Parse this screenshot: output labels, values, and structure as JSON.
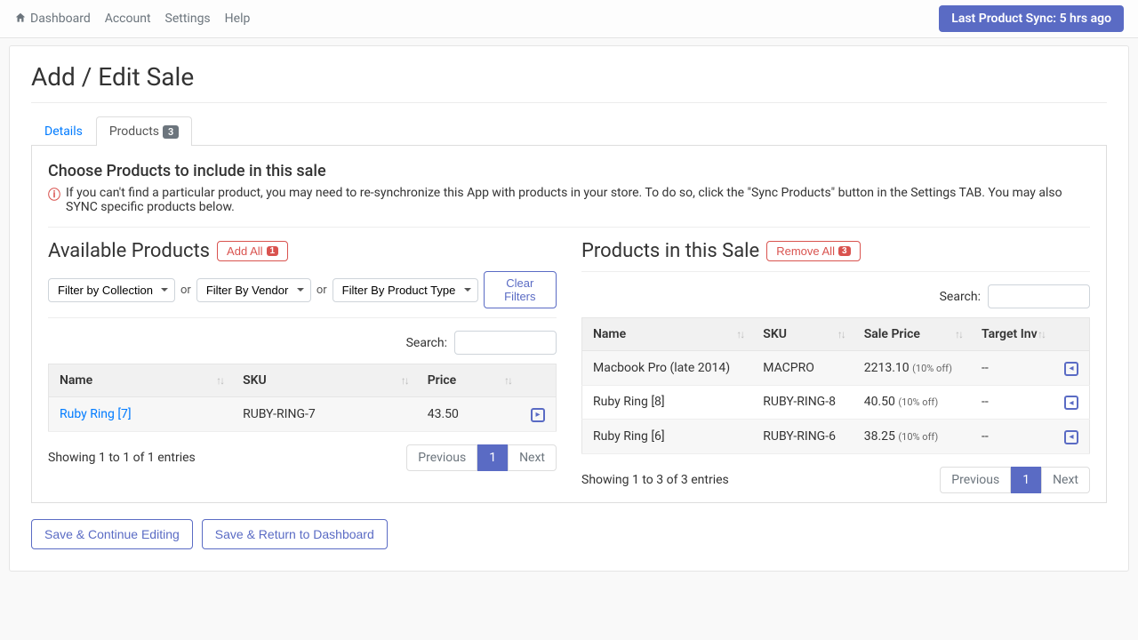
{
  "topbar": {
    "nav": {
      "dashboard": "Dashboard",
      "account": "Account",
      "settings": "Settings",
      "help": "Help"
    },
    "sync_label": "Last Product Sync: 5 hrs ago"
  },
  "page": {
    "title": "Add / Edit Sale"
  },
  "tabs": {
    "details": "Details",
    "products": "Products",
    "products_count": "3"
  },
  "choose": {
    "heading": "Choose Products to include in this sale",
    "help": "If you can't find a particular product, you may need to re-synchronize this App with products in your store. To do so, click the \"Sync Products\" button in the Settings TAB. You may also SYNC specific products below."
  },
  "available": {
    "heading": "Available Products",
    "add_all": "Add All",
    "add_all_count": "1",
    "filter_collection": "Filter by Collection",
    "filter_vendor": "Filter By Vendor",
    "filter_type": "Filter By Product Type",
    "clear_filters": "Clear Filters",
    "or": "or",
    "search_label": "Search:",
    "cols": {
      "name": "Name",
      "sku": "SKU",
      "price": "Price"
    },
    "rows": [
      {
        "name": "Ruby Ring [7]",
        "sku": "RUBY-RING-7",
        "price": "43.50"
      }
    ],
    "showing": "Showing 1 to 1 of 1 entries",
    "prev": "Previous",
    "page1": "1",
    "next": "Next"
  },
  "in_sale": {
    "heading": "Products in this Sale",
    "remove_all": "Remove All",
    "remove_all_count": "3",
    "search_label": "Search:",
    "cols": {
      "name": "Name",
      "sku": "SKU",
      "sale_price": "Sale Price",
      "target_inv": "Target Inv"
    },
    "rows": [
      {
        "name": "Macbook Pro (late 2014)",
        "sku": "MACPRO",
        "sale_price": "2213.10",
        "off": "(10% off)",
        "target_inv": "--"
      },
      {
        "name": "Ruby Ring [8]",
        "sku": "RUBY-RING-8",
        "sale_price": "40.50",
        "off": "(10% off)",
        "target_inv": "--"
      },
      {
        "name": "Ruby Ring [6]",
        "sku": "RUBY-RING-6",
        "sale_price": "38.25",
        "off": "(10% off)",
        "target_inv": "--"
      }
    ],
    "showing": "Showing 1 to 3 of 3 entries",
    "prev": "Previous",
    "page1": "1",
    "next": "Next"
  },
  "actions": {
    "save_continue": "Save & Continue Editing",
    "save_return": "Save & Return to Dashboard"
  }
}
